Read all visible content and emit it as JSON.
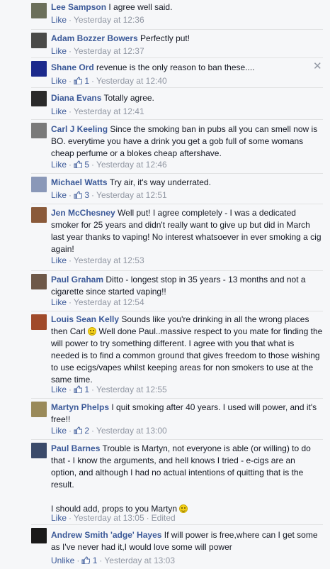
{
  "comments": [
    {
      "author": "Lee Sampson",
      "text": "I agree well said.",
      "actions": {
        "like": "Like",
        "time": "Yesterday at 12:36"
      }
    },
    {
      "author": "Adam Bozzer Bowers",
      "text": "Perfectly put!",
      "actions": {
        "like": "Like",
        "time": "Yesterday at 12:37"
      }
    },
    {
      "author": "Shane Ord",
      "text": "revenue is the only reason to ban these....",
      "actions": {
        "like": "Like",
        "likes": "1",
        "time": "Yesterday at 12:40"
      }
    },
    {
      "author": "Diana Evans",
      "text": "Totally agree.",
      "actions": {
        "like": "Like",
        "time": "Yesterday at 12:41"
      }
    },
    {
      "author": "Carl J Keeling",
      "text": "Since the smoking ban in pubs all you can smell now is BO. everytime you have a drink you get a gob full of some womans cheap perfume or a blokes cheap aftershave.",
      "actions": {
        "like": "Like",
        "likes": "5",
        "time": "Yesterday at 12:46"
      }
    },
    {
      "author": "Michael Watts",
      "text": "Try air, it's way underrated.",
      "actions": {
        "like": "Like",
        "likes": "3",
        "time": "Yesterday at 12:51"
      }
    },
    {
      "author": "Jen McChesney",
      "text": "Well put! I agree completely - I was a dedicated smoker for 25 years and didn't really want to give up but did in March last year thanks to vaping! No interest whatsoever in ever smoking a cig again!",
      "actions": {
        "like": "Like",
        "time": "Yesterday at 12:53"
      }
    },
    {
      "author": "Paul Graham",
      "text": "Ditto - longest stop in 35 years - 13 months and not a cigarette since started vaping!!",
      "actions": {
        "like": "Like",
        "time": "Yesterday at 12:54"
      }
    },
    {
      "author": "Louis Sean Kelly",
      "text_a": "Sounds like you're drinking in all the wrong places then Carl",
      "text_b": "Well done Paul..massive respect to you mate for finding the will power to try something different. I agree with you that what is needed is to find a common ground that gives freedom to those wishing to use ecigs/vapes whilst keeping areas for non smokers to use at the same time.",
      "actions": {
        "like": "Like",
        "likes": "1",
        "time": "Yesterday at 12:55"
      }
    },
    {
      "author": "Martyn Phelps",
      "text": "I quit smoking after 40 years. I used will power, and it's free!!",
      "actions": {
        "like": "Like",
        "likes": "2",
        "time": "Yesterday at 13:00"
      }
    },
    {
      "author": "Paul Barnes",
      "text": "Trouble is Martyn, not everyone is able (or willing) to do that - I know the arguments, and hell knows I tried - e-cigs are an option, and although I had no actual intentions of quitting that is the result.",
      "text_2": "I should add, props to you Martyn",
      "actions": {
        "like": "Like",
        "time": "Yesterday at 13:05",
        "edited": "Edited"
      }
    },
    {
      "author": "Andrew Smith 'adge' Hayes",
      "text": "If will power is free,where can I get some as I've never had it,I would love some will power",
      "actions": {
        "like": "Unlike",
        "likes": "1",
        "time": "Yesterday at 13:03"
      }
    }
  ],
  "colors": {
    "link": "#3b5998",
    "meta": "#9197a3",
    "background": "#f6f7f9"
  },
  "icons": {
    "like_count": "thumbs-up-icon",
    "remove": "close-icon",
    "emoticon": "smiley-icon"
  }
}
